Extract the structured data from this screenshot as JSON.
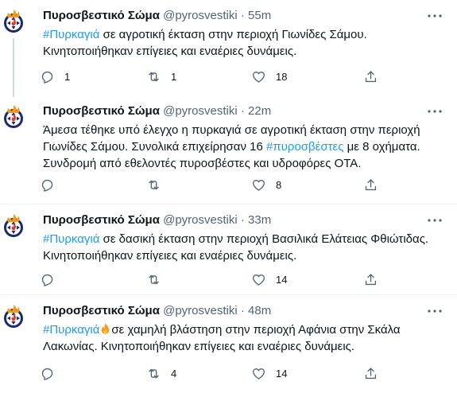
{
  "author": {
    "name": "Πυροσβεστικό Σώμα",
    "handle": "@pyrosvestiki"
  },
  "icons": {
    "reply": "reply-icon",
    "retweet": "retweet-icon",
    "like": "heart-icon",
    "share": "share-icon",
    "more": "more-icon",
    "fire": "fire-emoji"
  },
  "colors": {
    "link": "#1d9bf0",
    "muted": "#536471",
    "divider": "#eff3f4"
  },
  "tweets": [
    {
      "time": "55m",
      "text_tag": "#Πυρκαγιά",
      "text_line1": " σε αγροτική έκταση στην περιοχή Γιωνίδες Σάμου.",
      "text_line2": "Κινητοποιήθηκαν επίγειες και εναέριες δυνάμεις.",
      "replies": "1",
      "retweets": "1",
      "likes": "18"
    },
    {
      "time": "22m",
      "text_line1": "Άμεσα τέθηκε υπό έλεγχο η πυρκαγιά σε αγροτική έκταση στην περιοχή",
      "text_line2a": "Γιωνίδες Σάμου. Συνολικά επιχείρησαν 16 ",
      "text_tag": "#πυροσβέστες",
      "text_line2b": " με 8 οχήματα.",
      "text_line3": "Συνδρομή από εθελοντές πυροσβέστες και υδροφόρες ΟΤΑ.",
      "replies": "",
      "retweets": "",
      "likes": "8"
    },
    {
      "time": "33m",
      "text_tag": "#Πυρκαγιά",
      "text_line1": " σε δασική έκταση στην περιοχή Βασιλικά Ελάτειας Φθιώτιδας.",
      "text_line2": "Κινητοποιήθηκαν επίγειες και εναέριες δυνάμεις.",
      "replies": "",
      "retweets": "",
      "likes": "14"
    },
    {
      "time": "48m",
      "text_tag": "#Πυρκαγιά",
      "text_line1": "σε χαμηλή βλάστηση στην περιοχή Αφάνια στην Σκάλα",
      "text_line2": "Λακωνίας. Κινητοποιήθηκαν επίγειες και εναέριες δυνάμεις.",
      "replies": "",
      "retweets": "4",
      "likes": "14"
    }
  ]
}
